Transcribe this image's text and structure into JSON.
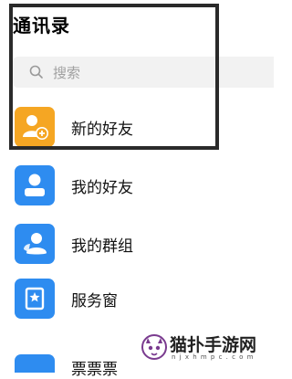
{
  "header": {
    "title": "通讯录"
  },
  "search": {
    "placeholder": "搜索",
    "icon": "search-icon"
  },
  "contacts": [
    {
      "label": "新的好友",
      "icon": "add-contact-icon",
      "color": "#f5a623"
    },
    {
      "label": "我的好友",
      "icon": "person-icon",
      "color": "#2e8cf0"
    },
    {
      "label": "我的群组",
      "icon": "group-icon",
      "color": "#2e8cf0"
    },
    {
      "label": "服务窗",
      "icon": "service-window-icon",
      "color": "#2e8cf0"
    }
  ],
  "bottom_partial": {
    "label": "票票票"
  },
  "watermark": {
    "text": "猫扑手游网",
    "url": "n j x h m p c . c o m"
  }
}
